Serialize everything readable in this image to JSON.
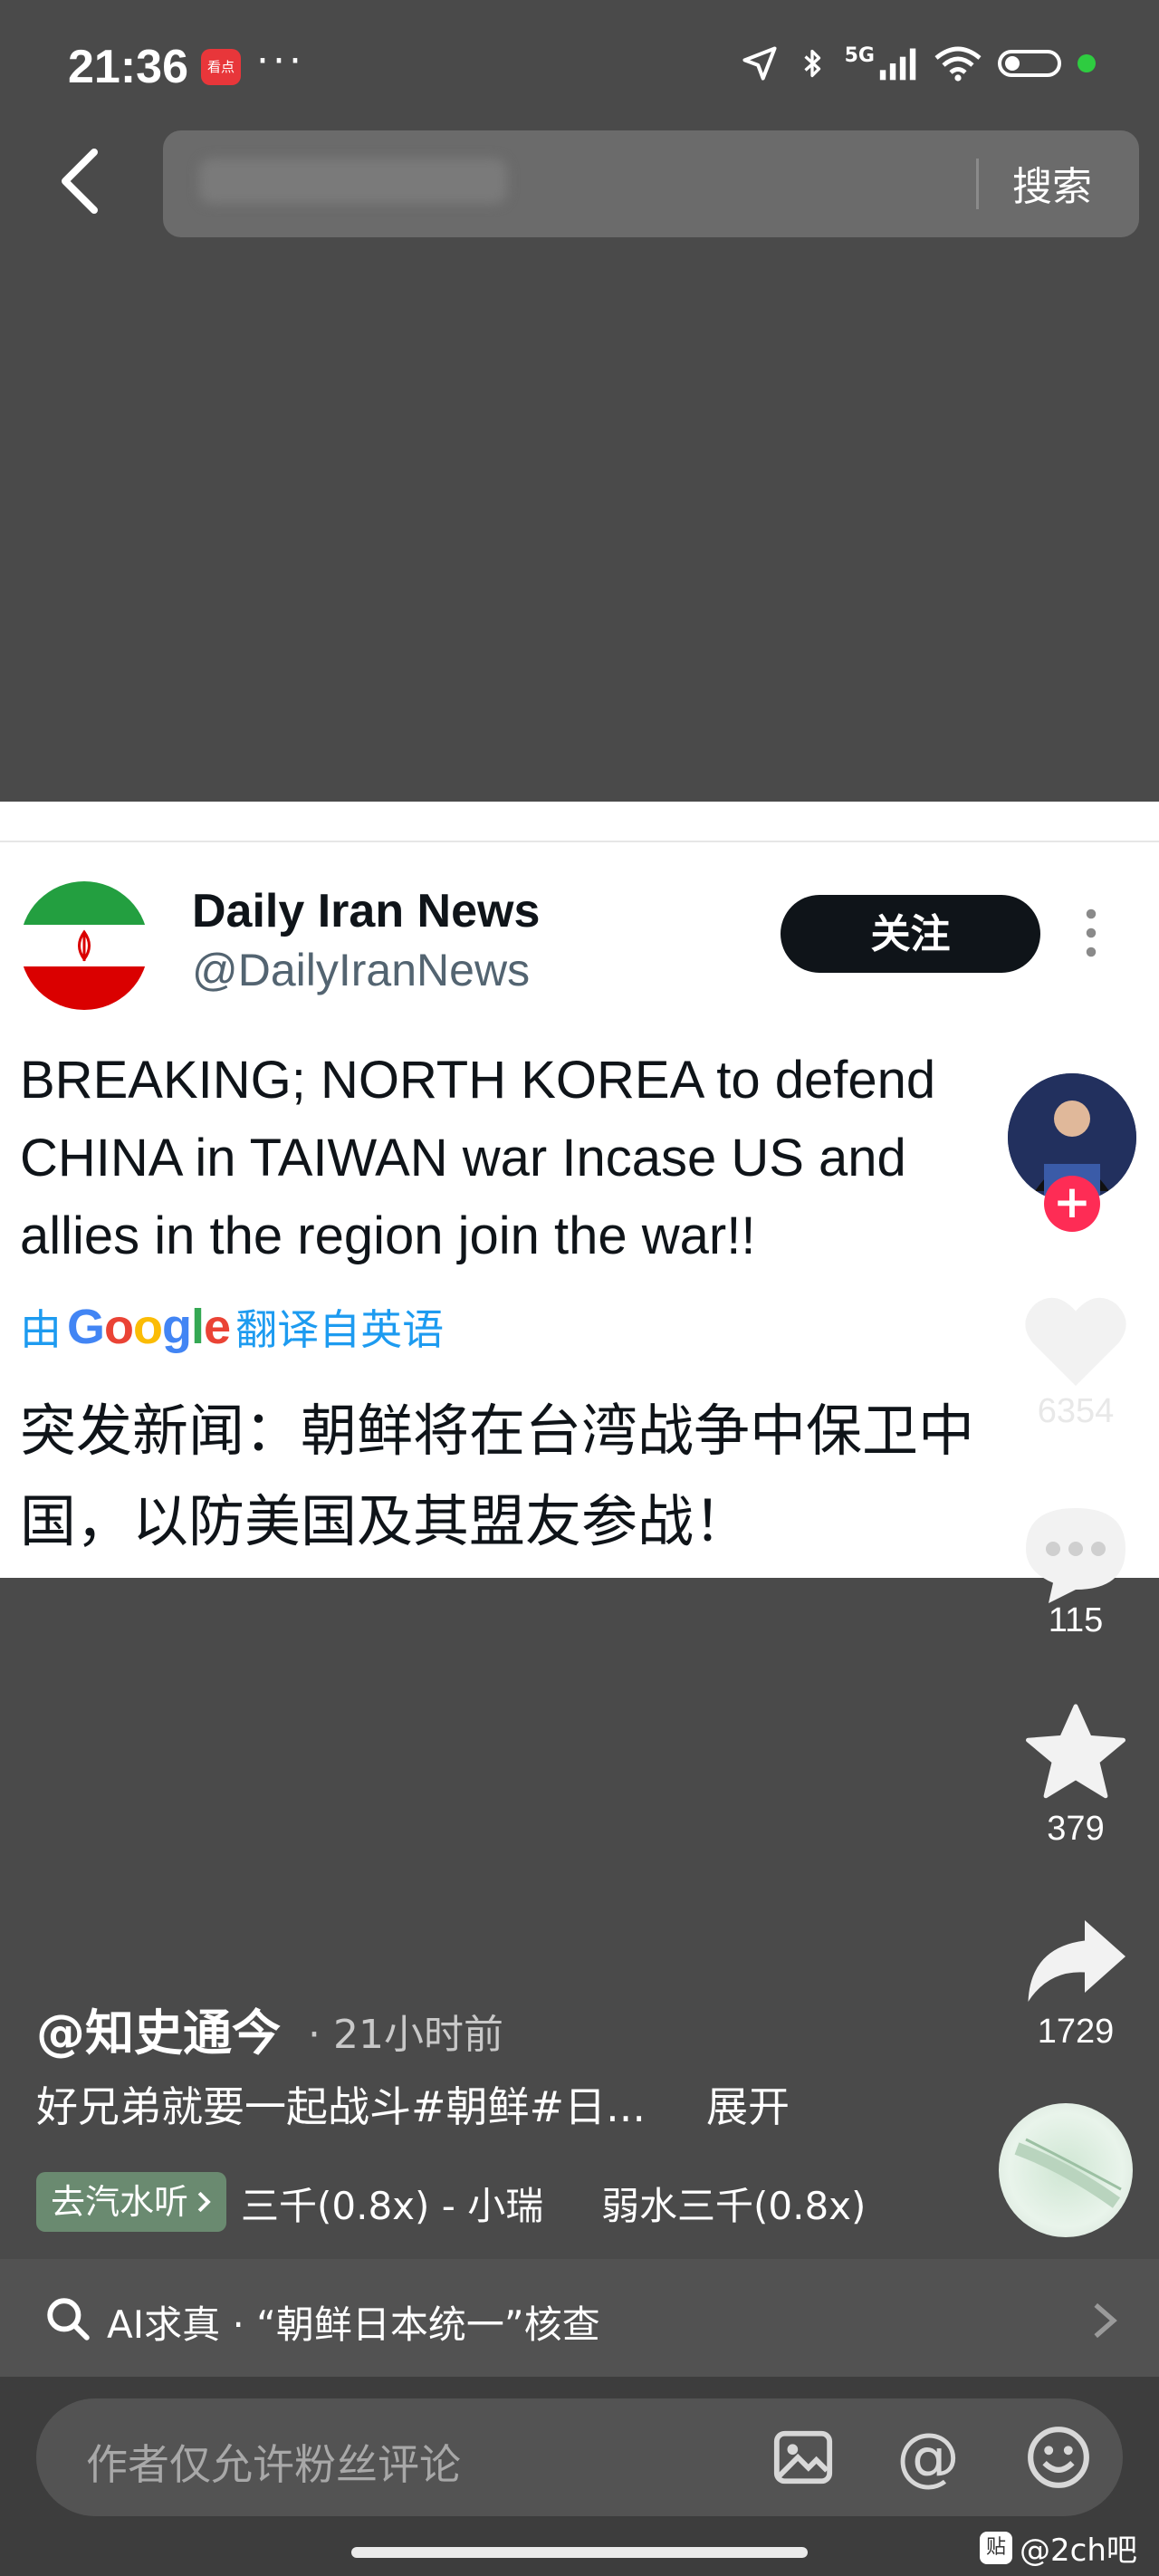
{
  "status_bar": {
    "time": "21:36",
    "app_badge": "看点",
    "dots": "···",
    "network": "5G"
  },
  "search": {
    "placeholder": "朝鲜日本统一",
    "button_label": "搜索"
  },
  "tweet": {
    "author_name": "Daily Iran News",
    "author_handle": "@DailyIranNews",
    "follow_label": "关注",
    "text_lines": [
      "BREAKING; NORTH KOREA to defend",
      "CHINA in TAIWAN war Incase US and",
      "allies in the region join the war!!"
    ],
    "translate_prefix": "由",
    "translate_brand": "Google",
    "translate_suffix": "翻译自英语",
    "translated_lines": [
      "突发新闻：朝鲜将在台湾战争中保卫中",
      "国，以防美国及其盟友参战！"
    ]
  },
  "actions": {
    "likes": "6354",
    "comments": "115",
    "favorites": "379",
    "shares": "1729"
  },
  "post": {
    "author": "@知史通今",
    "time": "· 21小时前",
    "caption": "好兄弟就要一起战斗#朝鲜#日...",
    "expand_label": "展开",
    "listen_chip": "去汽水听",
    "music_title_1": "三千(0.8x) - 小瑞",
    "music_title_2": "弱水三千(0.8x)"
  },
  "ai_bar": {
    "text": "AI求真 · “朝鲜日本统一”核查"
  },
  "comment": {
    "placeholder": "作者仅允许粉丝评论"
  },
  "watermark": {
    "badge": "贴",
    "text": "@2ch吧"
  },
  "colors": {
    "accent_red": "#fe2c55",
    "twitter_blue": "#1d9bf0",
    "follow_black": "#0f1419"
  }
}
